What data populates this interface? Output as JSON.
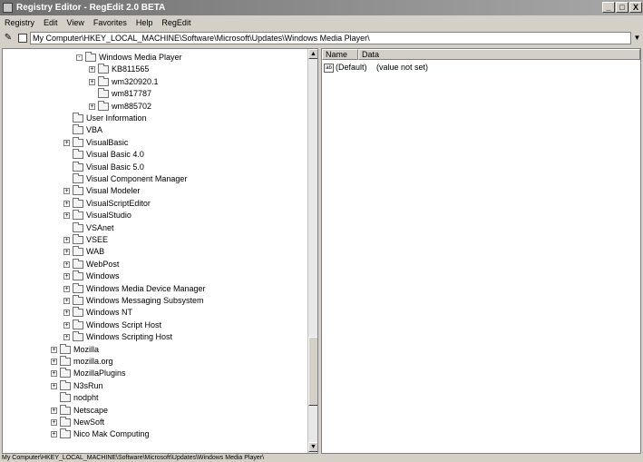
{
  "window": {
    "title": "Registry Editor - RegEdit 2.0 BETA",
    "minimize": "_",
    "maximize": "□",
    "close": "X"
  },
  "menu": [
    "Registry",
    "Edit",
    "View",
    "Favorites",
    "Help",
    "RegEdit"
  ],
  "address": {
    "path": "My Computer\\HKEY_LOCAL_MACHINE\\Software\\Microsoft\\Updates\\Windows Media Player\\"
  },
  "tree": [
    {
      "label": "Windows Media Player",
      "level": 2,
      "expander": "minus"
    },
    {
      "label": "KB811565",
      "level": 3,
      "expander": "plus"
    },
    {
      "label": "wm320920.1",
      "level": 3,
      "expander": "plus"
    },
    {
      "label": "wm817787",
      "level": 3,
      "expander": "none"
    },
    {
      "label": "wm885702",
      "level": 3,
      "expander": "plus"
    },
    {
      "label": "User Information",
      "level": 1,
      "expander": "none"
    },
    {
      "label": "VBA",
      "level": 1,
      "expander": "none"
    },
    {
      "label": "VisualBasic",
      "level": 1,
      "expander": "plus"
    },
    {
      "label": "Visual Basic 4.0",
      "level": 1,
      "expander": "none"
    },
    {
      "label": "Visual Basic 5.0",
      "level": 1,
      "expander": "none"
    },
    {
      "label": "Visual Component Manager",
      "level": 1,
      "expander": "none"
    },
    {
      "label": "Visual Modeler",
      "level": 1,
      "expander": "plus"
    },
    {
      "label": "VisualScriptEditor",
      "level": 1,
      "expander": "plus"
    },
    {
      "label": "VisualStudio",
      "level": 1,
      "expander": "plus"
    },
    {
      "label": "VSAnet",
      "level": 1,
      "expander": "none"
    },
    {
      "label": "VSEE",
      "level": 1,
      "expander": "plus"
    },
    {
      "label": "WAB",
      "level": 1,
      "expander": "plus"
    },
    {
      "label": "WebPost",
      "level": 1,
      "expander": "plus"
    },
    {
      "label": "Windows",
      "level": 1,
      "expander": "plus"
    },
    {
      "label": "Windows Media Device Manager",
      "level": 1,
      "expander": "plus"
    },
    {
      "label": "Windows Messaging Subsystem",
      "level": 1,
      "expander": "plus"
    },
    {
      "label": "Windows NT",
      "level": 1,
      "expander": "plus"
    },
    {
      "label": "Windows Script Host",
      "level": 1,
      "expander": "plus"
    },
    {
      "label": "Windows Scripting Host",
      "level": 1,
      "expander": "plus"
    },
    {
      "label": "Mozilla",
      "level": 0,
      "expander": "plus"
    },
    {
      "label": "mozilla.org",
      "level": 0,
      "expander": "plus"
    },
    {
      "label": "MozillaPlugins",
      "level": 0,
      "expander": "plus"
    },
    {
      "label": "N3sRun",
      "level": 0,
      "expander": "plus"
    },
    {
      "label": "nodpht",
      "level": 0,
      "expander": "none"
    },
    {
      "label": "Netscape",
      "level": 0,
      "expander": "plus"
    },
    {
      "label": "NewSoft",
      "level": 0,
      "expander": "plus"
    },
    {
      "label": "Nico Mak Computing",
      "level": 0,
      "expander": "plus"
    }
  ],
  "list": {
    "columns": [
      "Name",
      "Data"
    ],
    "rows": [
      {
        "name": "(Default)",
        "data": "(value not set)",
        "icon": "string-value-icon"
      }
    ]
  },
  "status": "My Computer\\HKEY_LOCAL_MACHINE\\Software\\Microsoft\\Updates\\Windows Media Player\\",
  "scroll": {
    "up": "▲",
    "down": "▼"
  },
  "address_dropdown": "▼"
}
